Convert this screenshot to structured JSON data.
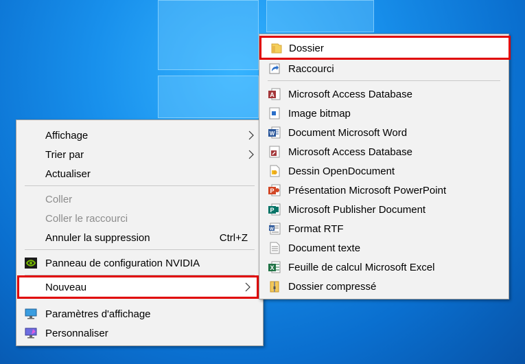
{
  "context_menu": {
    "items": [
      {
        "label": "Affichage"
      },
      {
        "label": "Trier par"
      },
      {
        "label": "Actualiser"
      },
      {
        "label": "Coller"
      },
      {
        "label": "Coller le raccourci"
      },
      {
        "label": "Annuler la suppression",
        "shortcut": "Ctrl+Z"
      },
      {
        "label": "Panneau de configuration NVIDIA",
        "icon": "nvidia-icon"
      },
      {
        "label": "Nouveau"
      },
      {
        "label": "Paramètres d'affichage",
        "icon": "display-settings-icon"
      },
      {
        "label": "Personnaliser",
        "icon": "personalize-icon"
      }
    ]
  },
  "submenu": {
    "items": [
      {
        "label": "Dossier",
        "icon": "folder-icon"
      },
      {
        "label": "Raccourci",
        "icon": "shortcut-icon"
      },
      {
        "label": "Microsoft Access Database",
        "icon": "access-icon",
        "color": "#a4373a"
      },
      {
        "label": "Image bitmap",
        "icon": "bitmap-icon"
      },
      {
        "label": "Document Microsoft Word",
        "icon": "word-icon",
        "color": "#2b579a"
      },
      {
        "label": "Microsoft Access Database",
        "icon": "access-icon",
        "color": "#a4373a"
      },
      {
        "label": "Dessin OpenDocument",
        "icon": "opendocument-drawing-icon"
      },
      {
        "label": "Présentation Microsoft PowerPoint",
        "icon": "powerpoint-icon",
        "color": "#d24726"
      },
      {
        "label": "Microsoft Publisher Document",
        "icon": "publisher-icon",
        "color": "#077568"
      },
      {
        "label": "Format RTF",
        "icon": "rtf-icon",
        "color": "#2b579a"
      },
      {
        "label": "Document texte",
        "icon": "text-document-icon"
      },
      {
        "label": "Feuille de calcul Microsoft Excel",
        "icon": "excel-icon",
        "color": "#217346"
      },
      {
        "label": "Dossier compressé",
        "icon": "zip-folder-icon"
      }
    ]
  },
  "colors": {
    "highlight": "#e00000",
    "menu_bg": "#f2f2f2"
  }
}
